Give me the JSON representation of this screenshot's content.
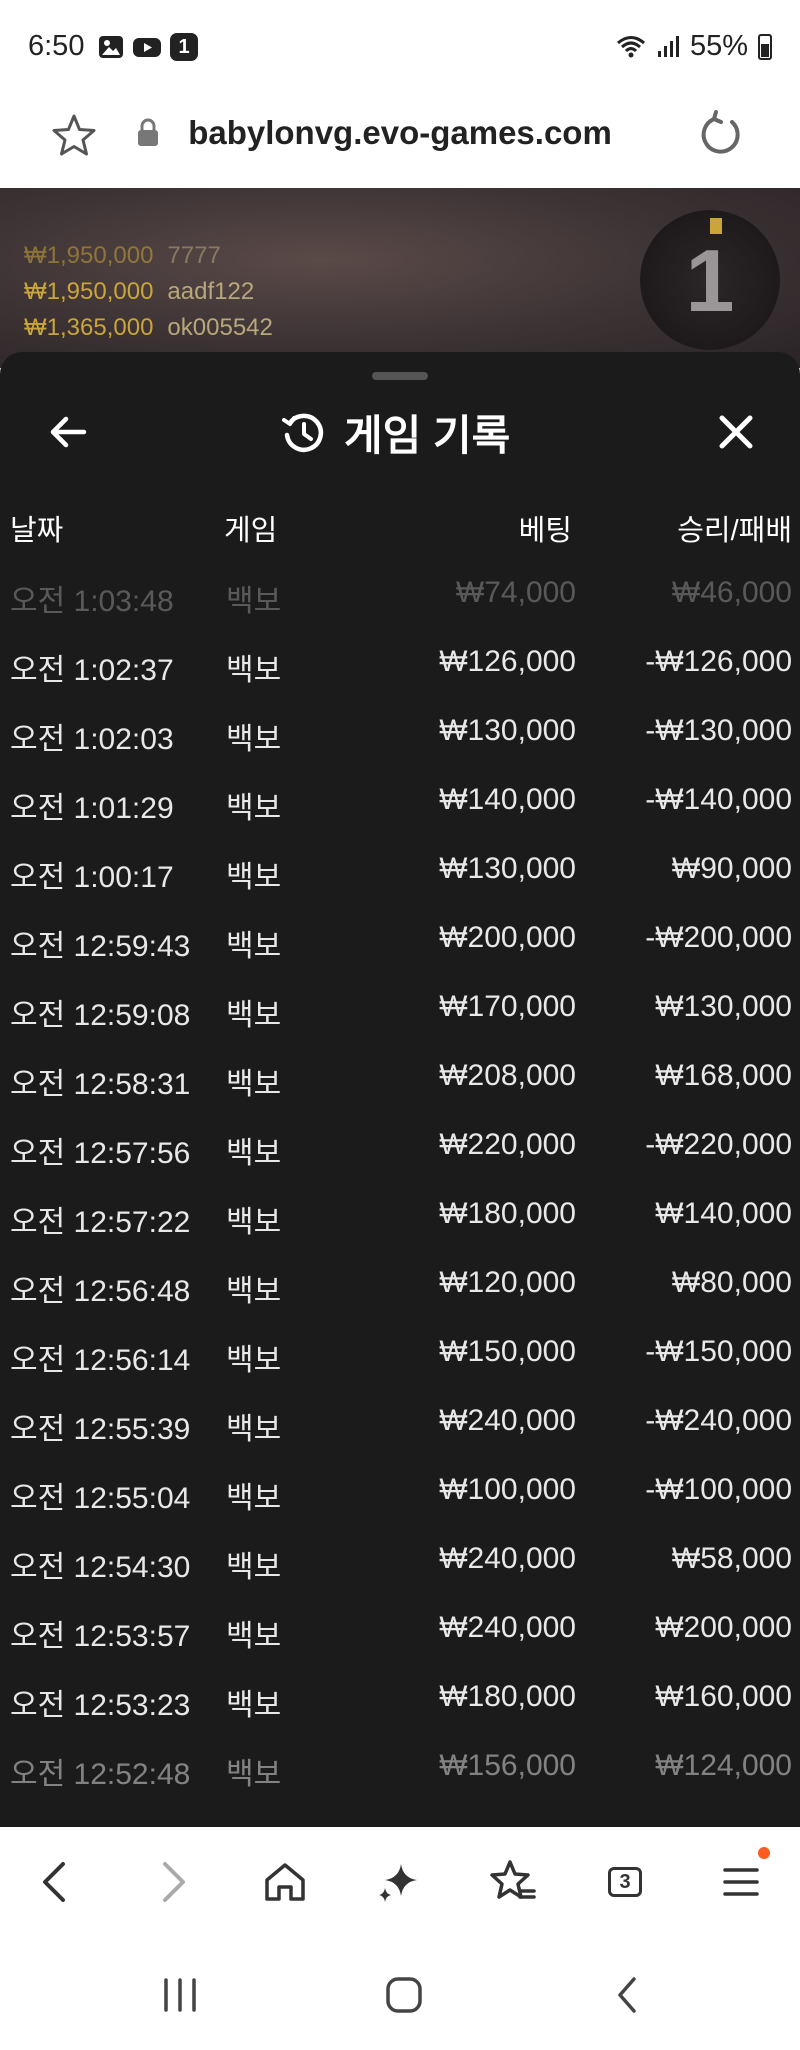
{
  "status_bar": {
    "time": "6:50",
    "notification_badge": "1",
    "battery": "55%"
  },
  "url_bar": {
    "url": "babylonvg.evo-games.com"
  },
  "winners": [
    {
      "amount": "₩1,950,000",
      "name": "7777"
    },
    {
      "amount": "₩1,950,000",
      "name": "aadf122"
    },
    {
      "amount": "₩1,365,000",
      "name": "ok005542"
    }
  ],
  "rank": "1",
  "panel": {
    "title": "게임 기록",
    "columns": {
      "date": "날짜",
      "game": "게임",
      "bet": "베팅",
      "result": "승리/패배"
    },
    "rows": [
      {
        "date": "오전 1:03:48",
        "game": "백보",
        "bet": "₩74,000",
        "result": "₩46,000"
      },
      {
        "date": "오전 1:02:37",
        "game": "백보",
        "bet": "₩126,000",
        "result": "-₩126,000"
      },
      {
        "date": "오전 1:02:03",
        "game": "백보",
        "bet": "₩130,000",
        "result": "-₩130,000"
      },
      {
        "date": "오전 1:01:29",
        "game": "백보",
        "bet": "₩140,000",
        "result": "-₩140,000"
      },
      {
        "date": "오전 1:00:17",
        "game": "백보",
        "bet": "₩130,000",
        "result": "₩90,000"
      },
      {
        "date": "오전 12:59:43",
        "game": "백보",
        "bet": "₩200,000",
        "result": "-₩200,000"
      },
      {
        "date": "오전 12:59:08",
        "game": "백보",
        "bet": "₩170,000",
        "result": "₩130,000"
      },
      {
        "date": "오전 12:58:31",
        "game": "백보",
        "bet": "₩208,000",
        "result": "₩168,000"
      },
      {
        "date": "오전 12:57:56",
        "game": "백보",
        "bet": "₩220,000",
        "result": "-₩220,000"
      },
      {
        "date": "오전 12:57:22",
        "game": "백보",
        "bet": "₩180,000",
        "result": "₩140,000"
      },
      {
        "date": "오전 12:56:48",
        "game": "백보",
        "bet": "₩120,000",
        "result": "₩80,000"
      },
      {
        "date": "오전 12:56:14",
        "game": "백보",
        "bet": "₩150,000",
        "result": "-₩150,000"
      },
      {
        "date": "오전 12:55:39",
        "game": "백보",
        "bet": "₩240,000",
        "result": "-₩240,000"
      },
      {
        "date": "오전 12:55:04",
        "game": "백보",
        "bet": "₩100,000",
        "result": "-₩100,000"
      },
      {
        "date": "오전 12:54:30",
        "game": "백보",
        "bet": "₩240,000",
        "result": "₩58,000"
      },
      {
        "date": "오전 12:53:57",
        "game": "백보",
        "bet": "₩240,000",
        "result": "₩200,000"
      },
      {
        "date": "오전 12:53:23",
        "game": "백보",
        "bet": "₩180,000",
        "result": "₩160,000"
      },
      {
        "date": "오전 12:52:48",
        "game": "백보",
        "bet": "₩156,000",
        "result": "₩124,000"
      }
    ]
  },
  "toolbar": {
    "tab_count": "3"
  },
  "colors": {
    "panel_bg": "#1b1b1b",
    "gold": "#c9a53a",
    "menu_dot": "#ff5a1f"
  }
}
